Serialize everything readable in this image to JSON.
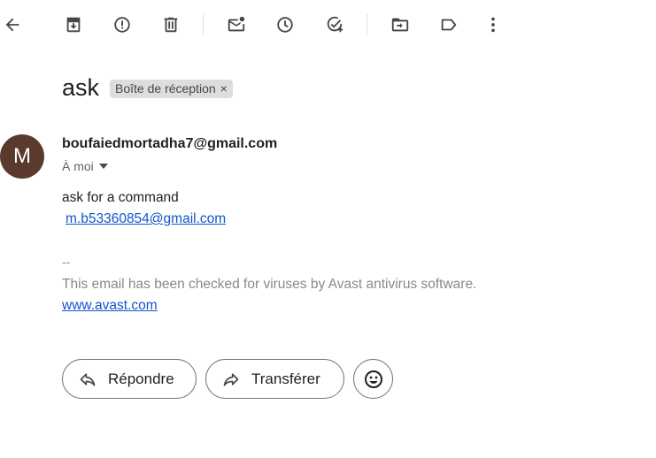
{
  "toolbar": {
    "icons": [
      "back-arrow-icon",
      "archive-icon",
      "report-spam-icon",
      "delete-icon",
      "mark-unread-icon",
      "snooze-icon",
      "add-to-tasks-icon",
      "move-to-icon",
      "label-icon",
      "more-vert-icon"
    ]
  },
  "email": {
    "subject": "ask",
    "label_chip": "Boîte de réception",
    "label_chip_close": "×",
    "avatar_initial": "M",
    "avatar_color": "#5a3a2e",
    "sender": "boufaiedmortadha7@gmail.com",
    "recipient": "À moi",
    "body_line": "ask for a command",
    "body_link": "m.b53360854@gmail.com",
    "signature_dash": "--",
    "signature_text": "This email has been checked for viruses by Avast antivirus software.",
    "signature_link": "www.avast.com",
    "link_color": "#1155cc"
  },
  "actions": {
    "reply_label": "Répondre",
    "forward_label": "Transférer"
  }
}
